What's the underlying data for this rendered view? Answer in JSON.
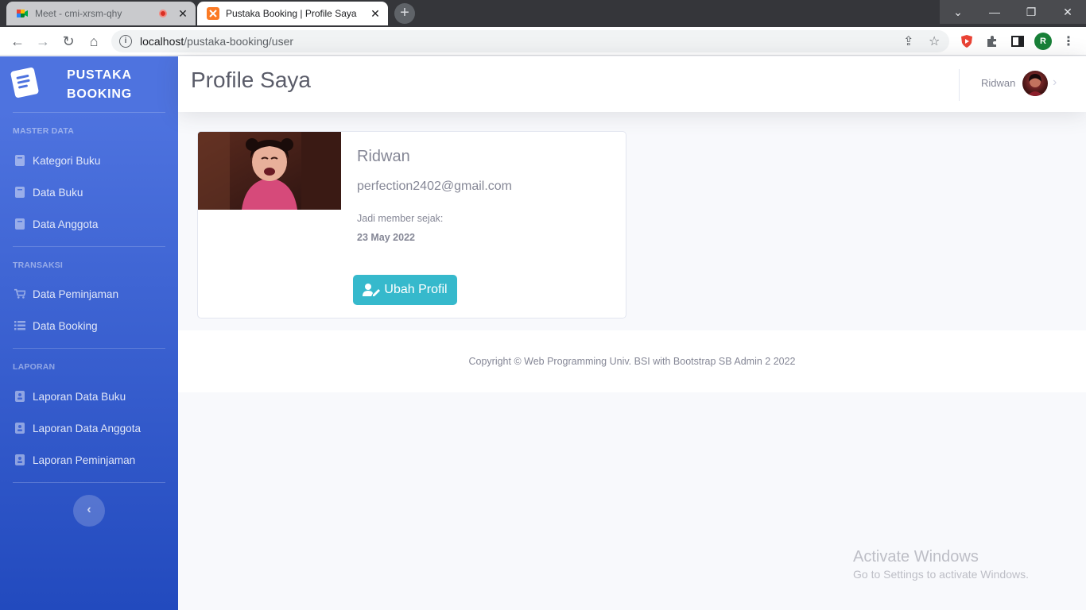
{
  "browser": {
    "tabs": [
      {
        "title": "Meet - cmi-xrsm-qhy",
        "active": false
      },
      {
        "title": "Pustaka Booking | Profile Saya",
        "active": true
      }
    ],
    "url_host": "localhost",
    "url_path": "/pustaka-booking/user",
    "profile_initial": "R"
  },
  "sidebar": {
    "brand": "PUSTAKA BOOKING",
    "sections": [
      {
        "heading": "MASTER DATA",
        "items": [
          {
            "label": "Kategori Buku",
            "icon": "book-icon"
          },
          {
            "label": "Data Buku",
            "icon": "book-icon"
          },
          {
            "label": "Data Anggota",
            "icon": "book-icon"
          }
        ]
      },
      {
        "heading": "TRANSAKSI",
        "items": [
          {
            "label": "Data Peminjaman",
            "icon": "cart-icon"
          },
          {
            "label": "Data Booking",
            "icon": "list-icon"
          }
        ]
      },
      {
        "heading": "LAPORAN",
        "items": [
          {
            "label": "Laporan Data Buku",
            "icon": "address-book-icon"
          },
          {
            "label": "Laporan Data Anggota",
            "icon": "address-book-icon"
          },
          {
            "label": "Laporan Peminjaman",
            "icon": "address-book-icon"
          }
        ]
      }
    ]
  },
  "topbar": {
    "title": "Profile Saya",
    "user_name": "Ridwan"
  },
  "profile": {
    "name": "Ridwan",
    "email": "perfection2402@gmail.com",
    "member_since_label": "Jadi member sejak:",
    "member_since_date": "23 May 2022",
    "edit_button": "Ubah Profil"
  },
  "footer": {
    "copyright": "Copyright © Web Programming Univ. BSI with Bootstrap SB Admin 2 2022"
  },
  "watermark": {
    "title": "Activate Windows",
    "subtitle": "Go to Settings to activate Windows."
  },
  "colors": {
    "primary": "#4e73df",
    "info": "#36b9cc",
    "text": "#858796"
  }
}
